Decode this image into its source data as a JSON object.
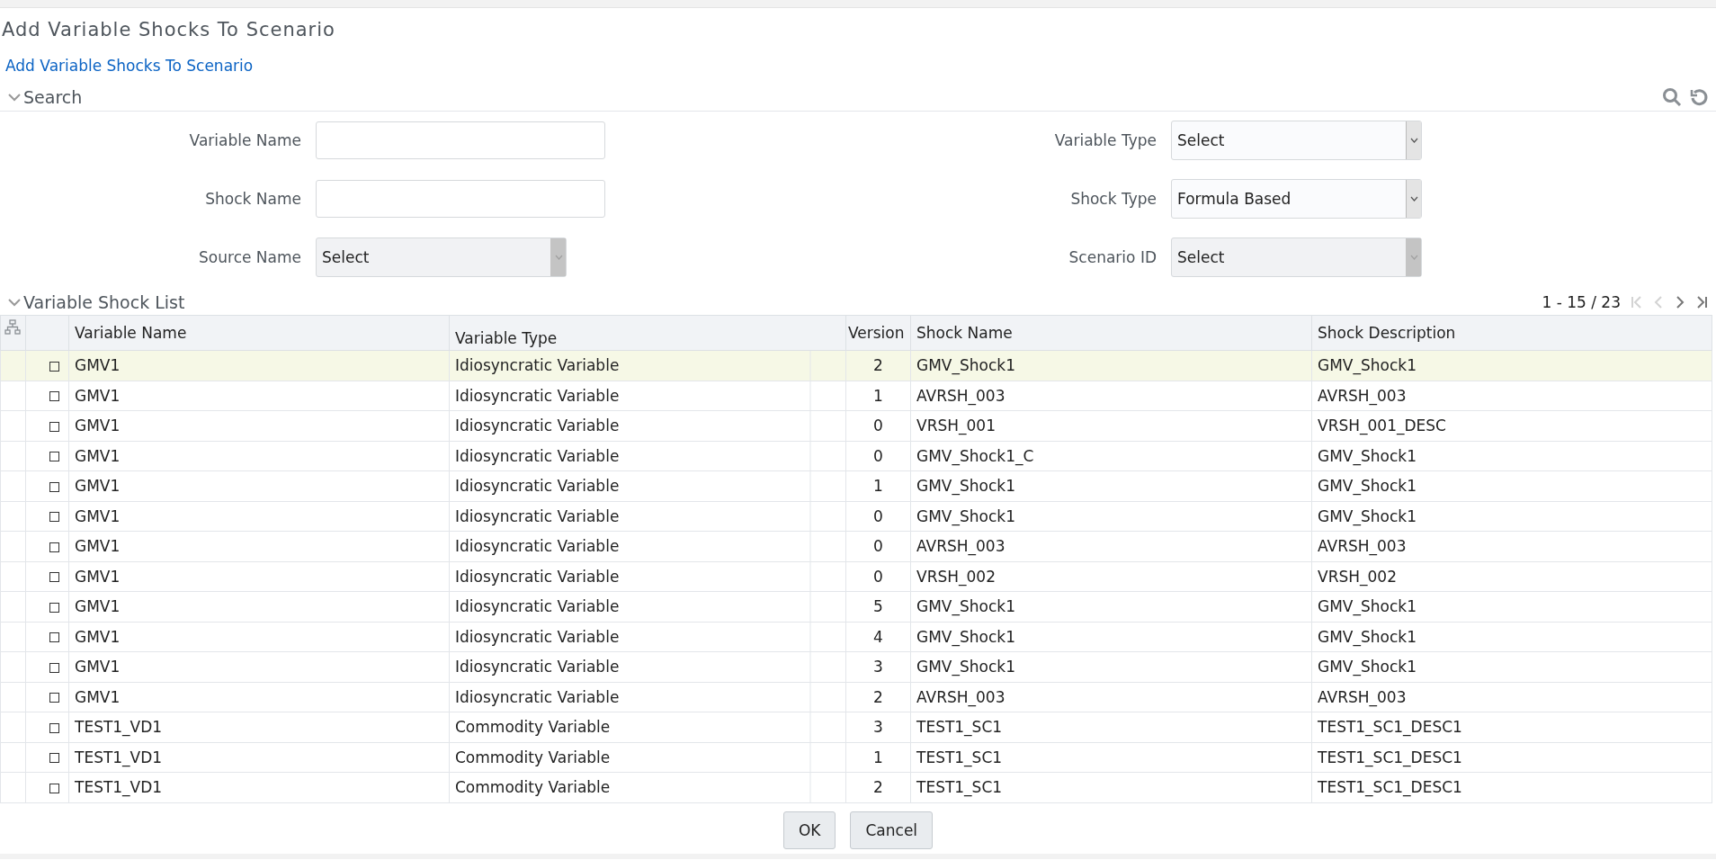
{
  "page_title": "Add Variable Shocks To Scenario",
  "breadcrumb_link": "Add Variable Shocks To Scenario",
  "search": {
    "title": "Search",
    "expanded": true,
    "fields": [
      {
        "label": "Variable Name",
        "kind": "text"
      },
      {
        "label": "Variable Type",
        "kind": "select",
        "value": "Select",
        "disabled": false
      },
      {
        "label": "Shock Name",
        "kind": "text"
      },
      {
        "label": "Shock Type",
        "kind": "select",
        "value": "Formula Based",
        "disabled": false
      },
      {
        "label": "Source Name",
        "kind": "select",
        "value": "Select",
        "disabled": true
      },
      {
        "label": "Scenario ID",
        "kind": "select",
        "value": "Select",
        "disabled": true
      }
    ]
  },
  "list": {
    "title": "Variable Shock List",
    "expanded": true,
    "pagination": "1 - 15 / 23",
    "pager": [
      {
        "kind": "first",
        "disabled": true
      },
      {
        "kind": "prev",
        "disabled": true
      },
      {
        "kind": "next",
        "disabled": false
      },
      {
        "kind": "last",
        "disabled": false
      }
    ],
    "columns": [
      "Variable Name",
      "Variable Type",
      "Version",
      "Shock Name",
      "Shock Description"
    ],
    "rows": [
      {
        "checked": false,
        "selected": true,
        "cells": [
          "GMV1",
          "Idiosyncratic Variable",
          "2",
          "GMV_Shock1",
          "GMV_Shock1"
        ]
      },
      {
        "checked": false,
        "selected": false,
        "cells": [
          "GMV1",
          "Idiosyncratic Variable",
          "1",
          "AVRSH_003",
          "AVRSH_003"
        ]
      },
      {
        "checked": false,
        "selected": false,
        "cells": [
          "GMV1",
          "Idiosyncratic Variable",
          "0",
          "VRSH_001",
          "VRSH_001_DESC"
        ]
      },
      {
        "checked": false,
        "selected": false,
        "cells": [
          "GMV1",
          "Idiosyncratic Variable",
          "0",
          "GMV_Shock1_C",
          "GMV_Shock1"
        ]
      },
      {
        "checked": false,
        "selected": false,
        "cells": [
          "GMV1",
          "Idiosyncratic Variable",
          "1",
          "GMV_Shock1",
          "GMV_Shock1"
        ]
      },
      {
        "checked": false,
        "selected": false,
        "cells": [
          "GMV1",
          "Idiosyncratic Variable",
          "0",
          "GMV_Shock1",
          "GMV_Shock1"
        ]
      },
      {
        "checked": false,
        "selected": false,
        "cells": [
          "GMV1",
          "Idiosyncratic Variable",
          "0",
          "AVRSH_003",
          "AVRSH_003"
        ]
      },
      {
        "checked": false,
        "selected": false,
        "cells": [
          "GMV1",
          "Idiosyncratic Variable",
          "0",
          "VRSH_002",
          "VRSH_002"
        ]
      },
      {
        "checked": false,
        "selected": false,
        "cells": [
          "GMV1",
          "Idiosyncratic Variable",
          "5",
          "GMV_Shock1",
          "GMV_Shock1"
        ]
      },
      {
        "checked": false,
        "selected": false,
        "cells": [
          "GMV1",
          "Idiosyncratic Variable",
          "4",
          "GMV_Shock1",
          "GMV_Shock1"
        ]
      },
      {
        "checked": false,
        "selected": false,
        "cells": [
          "GMV1",
          "Idiosyncratic Variable",
          "3",
          "GMV_Shock1",
          "GMV_Shock1"
        ]
      },
      {
        "checked": false,
        "selected": false,
        "cells": [
          "GMV1",
          "Idiosyncratic Variable",
          "2",
          "AVRSH_003",
          "AVRSH_003"
        ]
      },
      {
        "checked": false,
        "selected": false,
        "cells": [
          "TEST1_VD1",
          "Commodity Variable",
          "3",
          "TEST1_SC1",
          "TEST1_SC1_DESC1"
        ]
      },
      {
        "checked": false,
        "selected": false,
        "cells": [
          "TEST1_VD1",
          "Commodity Variable",
          "1",
          "TEST1_SC1",
          "TEST1_SC1_DESC1"
        ]
      },
      {
        "checked": false,
        "selected": false,
        "cells": [
          "TEST1_VD1",
          "Commodity Variable",
          "2",
          "TEST1_SC1",
          "TEST1_SC1_DESC1"
        ]
      }
    ]
  },
  "buttons": [
    "OK",
    "Cancel"
  ]
}
